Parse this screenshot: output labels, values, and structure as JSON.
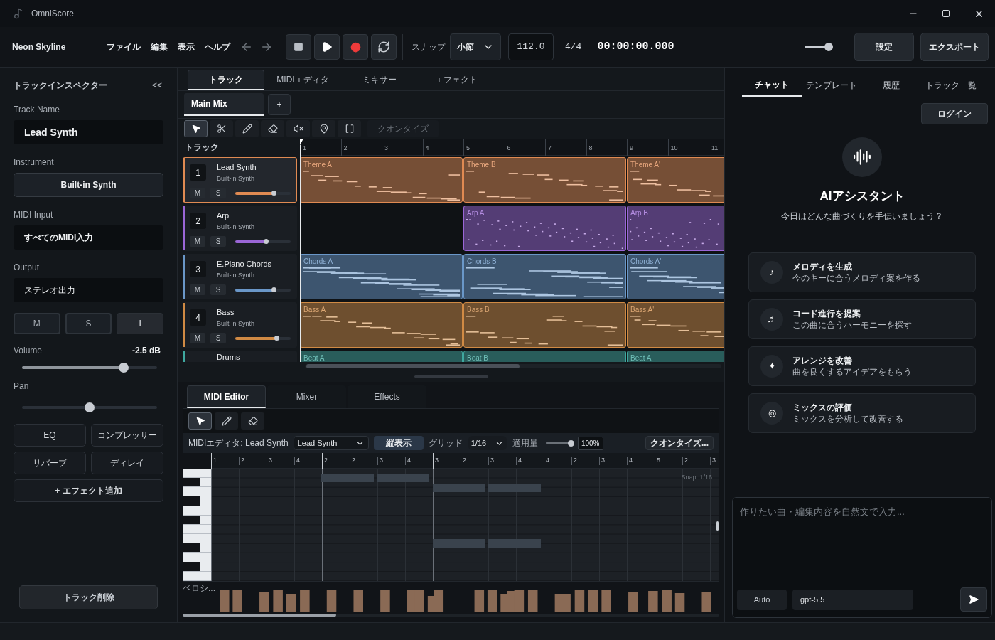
{
  "window": {
    "title": "OmniScore"
  },
  "toolbar": {
    "project": "Neon Skyline",
    "menus": [
      "ファイル",
      "編集",
      "表示",
      "ヘルプ"
    ],
    "transport": [
      {
        "kind": "stop"
      },
      {
        "kind": "play"
      },
      {
        "kind": "record"
      },
      {
        "kind": "loop"
      }
    ],
    "snap_label": "スナップ",
    "snap_value": "小節",
    "tempo": "112.0",
    "meter": "4/4",
    "time": "00:00:00.000",
    "master": {
      "level": 0.85
    },
    "buttons": [
      "設定",
      "エクスポート"
    ]
  },
  "inspector": {
    "title": "トラックインスペクター",
    "collapse": "<<",
    "fields": [
      {
        "label": "Track Name",
        "value": "Lead Synth",
        "kind": "input"
      },
      {
        "label": "Instrument",
        "value": "Built-in Synth",
        "kind": "button"
      },
      {
        "label": "MIDI Input",
        "value": "すべてのMIDI入力",
        "kind": "input"
      },
      {
        "label": "Output",
        "value": "ステレオ出力",
        "kind": "select"
      }
    ],
    "toggles": [
      {
        "label": "M",
        "selected": false
      },
      {
        "label": "S",
        "selected": false
      },
      {
        "label": "I",
        "selected": true
      }
    ],
    "volume": {
      "label": "Volume",
      "reading": "-2.5 dB",
      "level": 0.75
    },
    "pan": {
      "label": "Pan",
      "level": 0.5
    },
    "effects": [
      "EQ",
      "コンプレッサー",
      "リバーブ",
      "ディレイ"
    ],
    "add_effect": "+ エフェクト追加",
    "delete": "トラック削除"
  },
  "arrange": {
    "tabs": [
      {
        "label": "トラック",
        "selected": true
      },
      {
        "label": "MIDIエディタ",
        "selected": false
      },
      {
        "label": "ミキサー",
        "selected": false
      },
      {
        "label": "エフェクト",
        "selected": false
      }
    ],
    "mix_tabs": [
      {
        "label": "Main Mix",
        "selected": true
      }
    ],
    "add": "+",
    "tools": [
      {
        "kind": "select",
        "selected": true
      },
      {
        "kind": "cut",
        "selected": false
      },
      {
        "kind": "pencil",
        "selected": false
      },
      {
        "kind": "erase",
        "selected": false
      },
      {
        "kind": "mute",
        "selected": false
      },
      {
        "kind": "pin",
        "selected": false
      },
      {
        "kind": "bracket",
        "selected": false
      }
    ],
    "quantize": "クオンタイズ",
    "track_header": "トラック",
    "ruler": [
      "1",
      "2",
      "3",
      "4",
      "5",
      "6",
      "7",
      "8",
      "9",
      "10",
      "11"
    ],
    "tracks": [
      {
        "number": "1",
        "name": "Lead Synth",
        "instrument": "Built-in Synth",
        "mute": "M",
        "solo": "S",
        "level": 0.7,
        "color": "#e08a52",
        "selected": true,
        "clips": [
          {
            "label": "Theme A"
          },
          {
            "label": "Theme B"
          },
          {
            "label": "Theme A'"
          }
        ]
      },
      {
        "number": "2",
        "name": "Arp",
        "instrument": "Built-in Synth",
        "mute": "M",
        "solo": "S",
        "level": 0.56,
        "color": "#9a66d6",
        "selected": false,
        "clips": [
          {
            "kind": "gap"
          },
          {
            "kind": "clip",
            "label": "Arp A"
          },
          {
            "kind": "clip",
            "label": "Arp B"
          }
        ]
      },
      {
        "number": "3",
        "name": "E.Piano Chords",
        "instrument": "Built-in Synth",
        "mute": "M",
        "solo": "S",
        "level": 0.7,
        "color": "#6a97c8",
        "selected": false,
        "clips": [
          {
            "label": "Chords A"
          },
          {
            "label": "Chords B"
          },
          {
            "label": "Chords A'"
          }
        ]
      },
      {
        "number": "4",
        "name": "Bass",
        "instrument": "Built-in Synth",
        "mute": "M",
        "solo": "S",
        "level": 0.75,
        "color": "#d08a44",
        "selected": false,
        "clips": [
          {
            "label": "Bass A"
          },
          {
            "label": "Bass B"
          },
          {
            "label": "Bass A'"
          }
        ]
      },
      {
        "name": "Drums",
        "color": "#3fa89f",
        "selected": false,
        "clips": [
          {
            "label": "Beat A"
          },
          {
            "label": "Beat B"
          },
          {
            "label": "Beat A'"
          }
        ]
      }
    ]
  },
  "editor": {
    "tabs": [
      {
        "label": "MIDI Editor",
        "selected": true
      },
      {
        "label": "Mixer",
        "selected": false
      },
      {
        "label": "Effects",
        "selected": false
      }
    ],
    "tools": [
      {
        "kind": "select",
        "selected": true
      },
      {
        "kind": "pencil",
        "selected": false
      },
      {
        "kind": "erase",
        "selected": false
      }
    ],
    "caption": "MIDIエディタ: Lead Synth",
    "track_select": "Lead Synth",
    "view_button": "縦表示",
    "grid_label": "グリッド",
    "grid_value": "1/16",
    "amount_label": "適用量",
    "amount": {
      "level": 0.95
    },
    "amount_value": "100%",
    "quantize_button": "クオンタイズ...",
    "ruler": [
      "1",
      "2",
      "3",
      "4",
      "2",
      "2",
      "3",
      "4",
      "3",
      "2",
      "3",
      "4",
      "4",
      "2",
      "3",
      "4",
      "5",
      "2",
      "3"
    ],
    "snap": "Snap: 1/16",
    "velocity_label": "ベロシ..."
  },
  "assistant": {
    "tabs": [
      {
        "label": "チャット",
        "selected": true
      },
      {
        "label": "テンプレート",
        "selected": false
      },
      {
        "label": "履歴",
        "selected": false
      },
      {
        "label": "トラック一覧",
        "selected": false
      }
    ],
    "login": "ログイン",
    "title": "AIアシスタント",
    "subtitle": "今日はどんな曲づくりを手伝いましょう？",
    "suggestions": [
      {
        "icon": "♪",
        "title": "メロディを生成",
        "description": "今のキーに合うメロディ案を作る"
      },
      {
        "icon": "♬",
        "title": "コード進行を提案",
        "description": "この曲に合うハーモニーを探す"
      },
      {
        "icon": "✦",
        "title": "アレンジを改善",
        "description": "曲を良くするアイデアをもらう"
      },
      {
        "icon": "◎",
        "title": "ミックスの評価",
        "description": "ミックスを分析して改善する"
      }
    ],
    "placeholder": "作りたい曲・編集内容を自然文で入力...",
    "mode": "Auto",
    "model": "gpt-5.5"
  }
}
